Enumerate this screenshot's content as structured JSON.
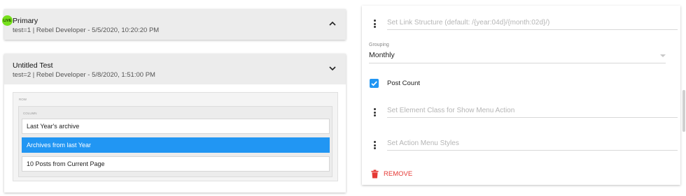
{
  "tests": [
    {
      "title": "Primary",
      "subtitle": "test=1 | Rebel Developer - 5/5/2020, 10:20:20 PM",
      "badge": "LIVE",
      "expanded": false
    },
    {
      "title": "Untitled Test",
      "subtitle": "test=2 | Rebel Developer - 5/8/2020, 1:51:00 PM",
      "expanded": true,
      "row_label": "ROW",
      "column_label": "COLUMN",
      "items": [
        {
          "label": "Last Year's archive",
          "selected": false
        },
        {
          "label": "Archives from last Year",
          "selected": true
        },
        {
          "label": "10 Posts from Current Page",
          "selected": false
        }
      ]
    }
  ],
  "settings": {
    "link_structure": {
      "placeholder": "Set Link Structure (default: /{year:04d}/{month:02d}/)",
      "value": ""
    },
    "grouping": {
      "label": "Grouping",
      "value": "Monthly"
    },
    "post_count": {
      "label": "Post Count",
      "checked": true
    },
    "element_class": {
      "placeholder": "Set Element Class for Show Menu Action",
      "value": ""
    },
    "action_menu_styles": {
      "placeholder": "Set Action Menu Styles",
      "value": ""
    },
    "remove_label": "REMOVE"
  },
  "icons": {
    "kebab": "more-vert-icon",
    "chevron_up": "chevron-up-icon",
    "chevron_down": "chevron-down-icon",
    "check": "check-icon",
    "trash": "trash-icon"
  },
  "colors": {
    "accent": "#2196f3",
    "live_badge": "#76e01b",
    "danger": "#e53935",
    "header_bg": "#ececec"
  }
}
